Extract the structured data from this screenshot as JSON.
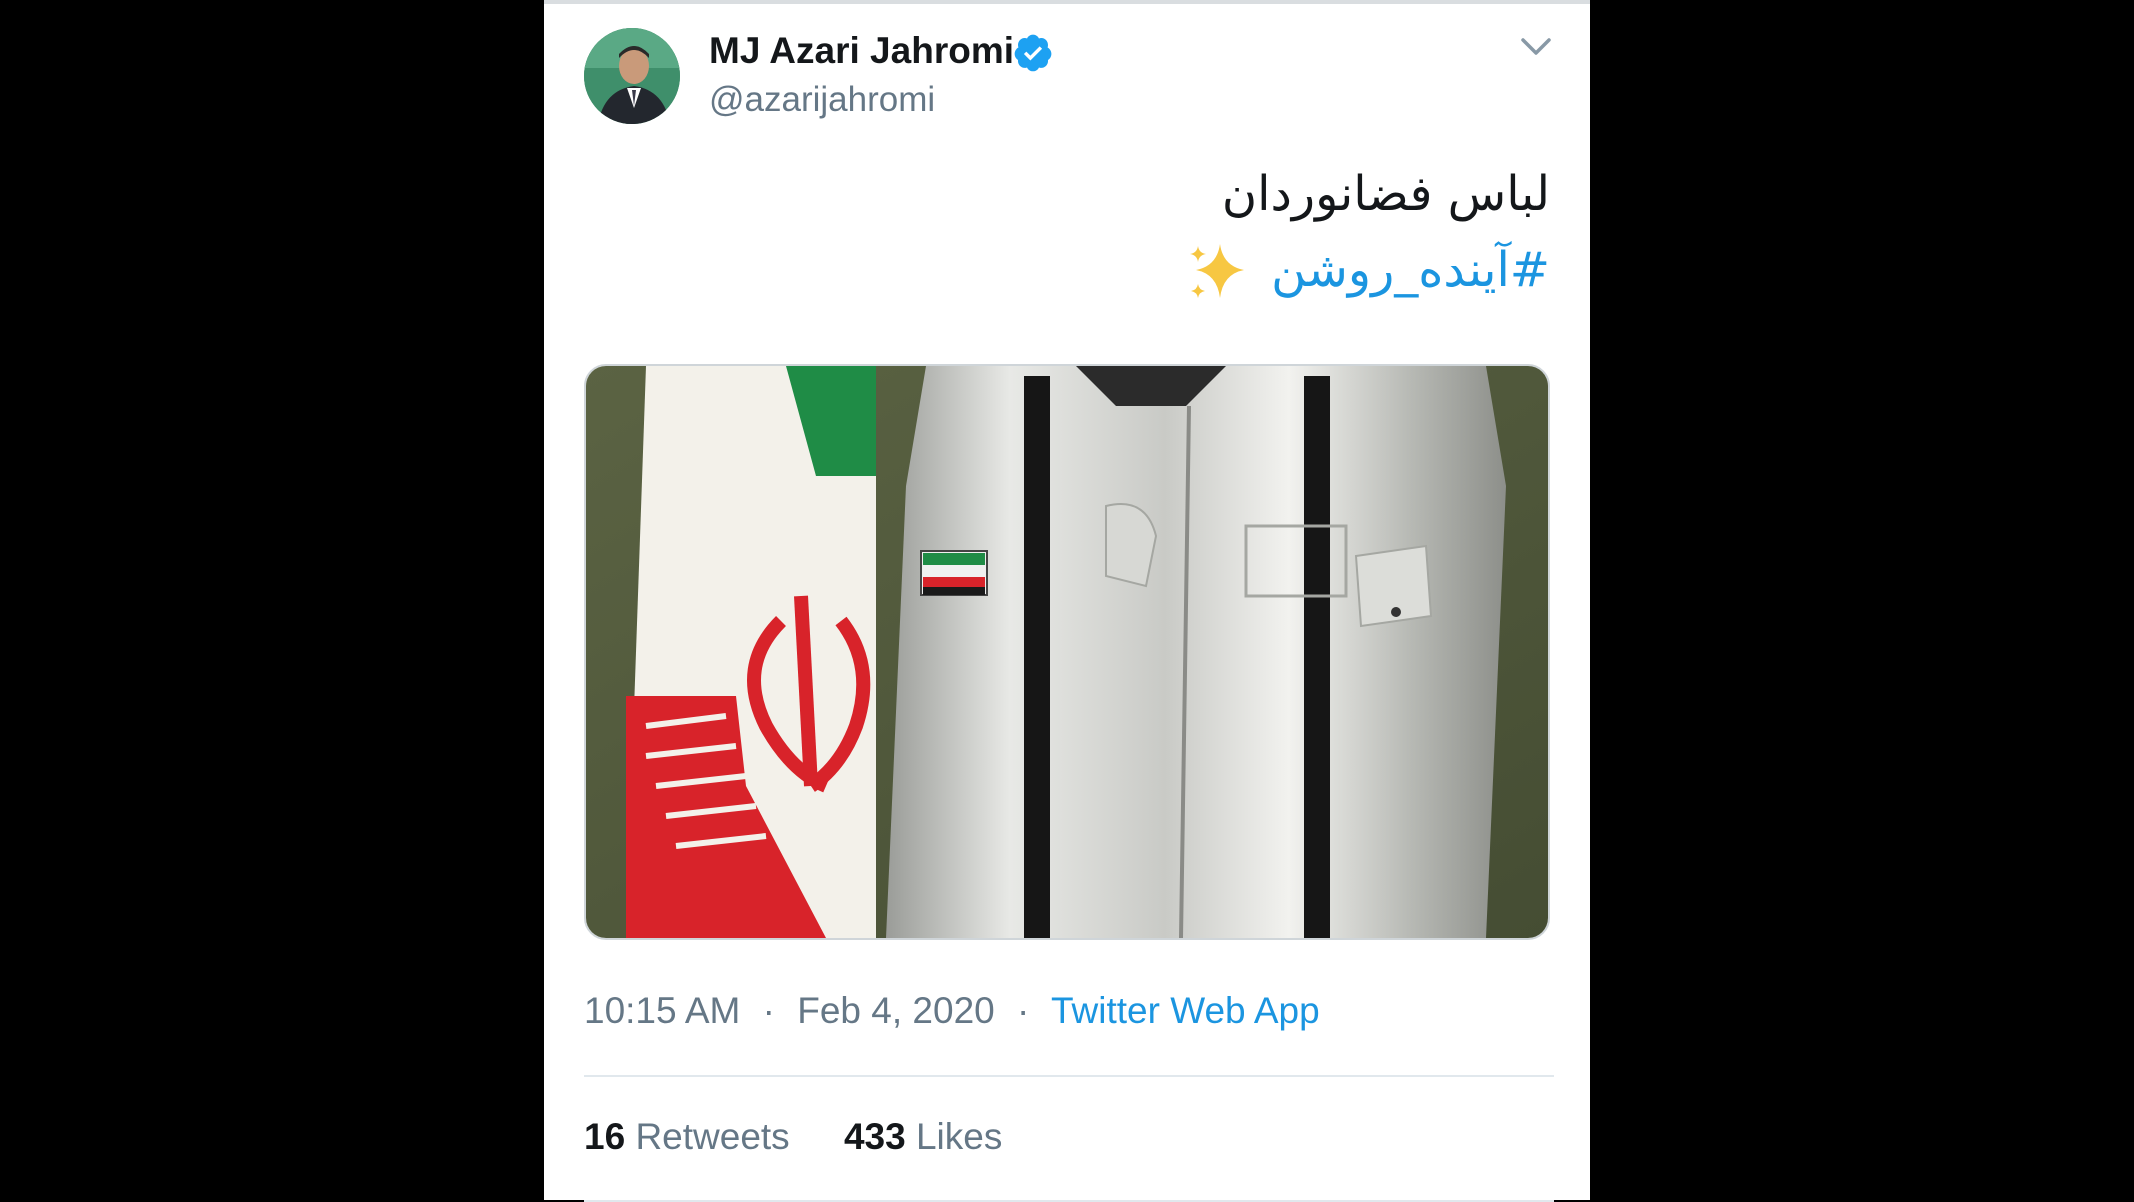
{
  "author": {
    "display_name": "MJ Azari Jahromi",
    "handle": "@azarijahromi",
    "verified": true
  },
  "icons": {
    "verified": "verified-badge-icon",
    "menu": "chevron-down-icon",
    "emoji": "sparkles-emoji"
  },
  "tweet": {
    "text_line1": "لباس فضانوردان",
    "hashtag": "#آینده_روشن"
  },
  "meta": {
    "time": "10:15 AM",
    "date": "Feb 4, 2020",
    "separator": "·",
    "source": "Twitter Web App"
  },
  "stats": {
    "retweets_count": "16",
    "retweets_label": "Retweets",
    "likes_count": "433",
    "likes_label": "Likes"
  },
  "colors": {
    "link": "#1b95e0",
    "text": "#14171a",
    "muted": "#657786",
    "background": "#000000"
  }
}
